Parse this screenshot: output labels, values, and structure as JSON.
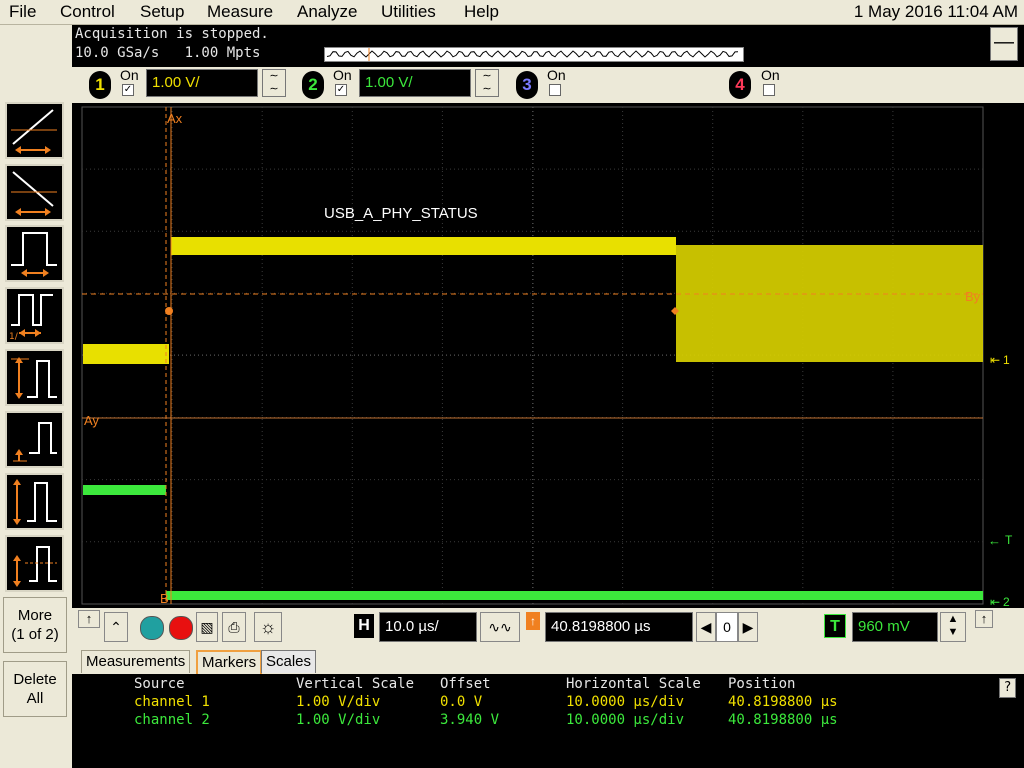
{
  "menu": {
    "items": [
      "File",
      "Control",
      "Setup",
      "Measure",
      "Analyze",
      "Utilities",
      "Help"
    ],
    "datetime": "1 May 2016 11:04 AM"
  },
  "header": {
    "status": "Acquisition is stopped.",
    "sample_info": "10.0 GSa/s   1.00 Mpts",
    "close_label": "—"
  },
  "channels": [
    {
      "number": "1",
      "on_label": "On",
      "checked": "✓",
      "scale": "1.00 V/",
      "color": "#f0e000"
    },
    {
      "number": "2",
      "on_label": "On",
      "checked": "✓",
      "scale": "1.00 V/",
      "color": "#3ce83c"
    },
    {
      "number": "3",
      "on_label": "On",
      "checked": "",
      "color": "#7a7aff"
    },
    {
      "number": "4",
      "on_label": "On",
      "checked": "",
      "color": "#ff3a5a"
    }
  ],
  "display": {
    "annotation": "USB_A_PHY_STATUS",
    "markers": {
      "ax": "Ax",
      "ay": "Ay",
      "by": "By",
      "bx": "B"
    },
    "ch1_marker": "1",
    "ch2_marker": "2",
    "trigger_marker": "T"
  },
  "controls": {
    "h_label": "H",
    "h_scale": "10.0 µs/",
    "h_position": "40.8198800 µs",
    "ref_position": "0",
    "t_label": "T",
    "trigger_level": "960 mV"
  },
  "left_panel": {
    "more_label": "More\n(1 of 2)",
    "more_line1": "More",
    "more_line2": "(1 of 2)",
    "delete_line1": "Delete",
    "delete_line2": "All"
  },
  "tabs": [
    "Measurements",
    "Markers",
    "Scales"
  ],
  "active_tab": "Scales",
  "scales_table": {
    "headers": [
      "Source",
      "Vertical Scale",
      "Offset",
      "Horizontal Scale",
      "Position"
    ],
    "rows": [
      [
        "channel 1",
        "1.00 V/div",
        "0.0 V",
        "10.0000 µs/div",
        "40.8198800 µs"
      ],
      [
        "channel 2",
        "1.00 V/div",
        "3.940 V",
        "10.0000 µs/div",
        "40.8198800 µs"
      ]
    ]
  },
  "help_label": "?"
}
